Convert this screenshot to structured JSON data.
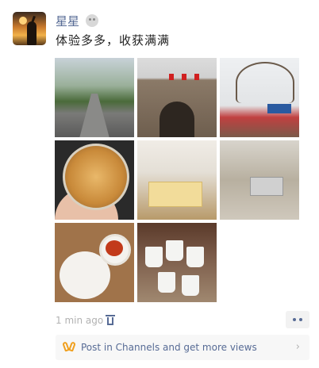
{
  "post": {
    "username": "星星",
    "text": "体验多多，收获满满",
    "time": "1 min ago",
    "photo_count": 8
  },
  "icons": {
    "emoji": "smiley-face-icon",
    "delete": "trash-icon",
    "more": "more-dots-icon",
    "channels": "channels-logo-icon",
    "arrow": "chevron-right-icon"
  },
  "channels": {
    "label": "Post in Channels and get more views",
    "arrow": "›"
  },
  "colors": {
    "link": "#576b95",
    "accent": "#f0a020",
    "muted": "#b2b2b2"
  }
}
